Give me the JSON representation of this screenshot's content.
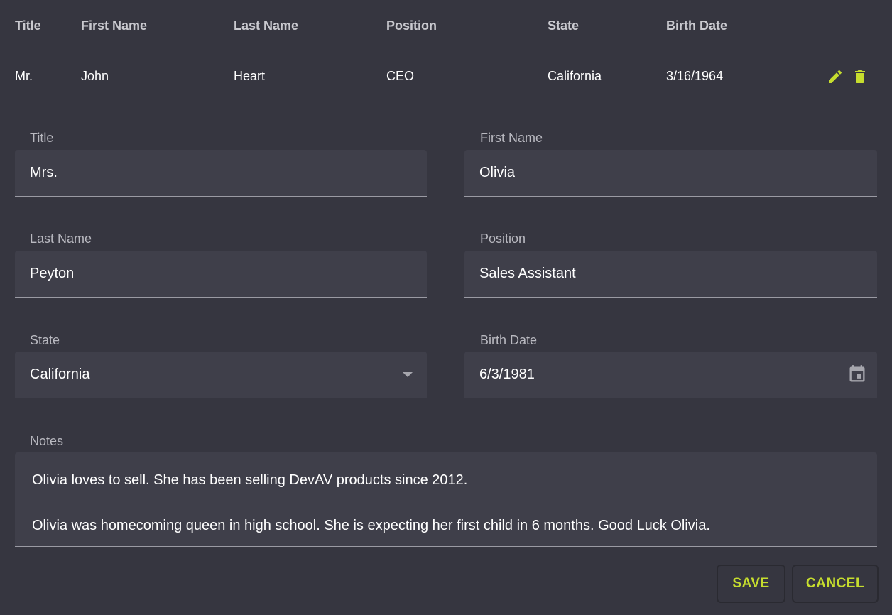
{
  "grid": {
    "columns": [
      "Title",
      "First Name",
      "Last Name",
      "Position",
      "State",
      "Birth Date"
    ],
    "row": {
      "title": "Mr.",
      "first_name": "John",
      "last_name": "Heart",
      "position": "CEO",
      "state": "California",
      "birth_date": "3/16/1964"
    },
    "icons": {
      "edit": "pencil-icon",
      "delete": "trash-icon"
    }
  },
  "form": {
    "title": {
      "label": "Title",
      "value": "Mrs."
    },
    "first_name": {
      "label": "First Name",
      "value": "Olivia"
    },
    "last_name": {
      "label": "Last Name",
      "value": "Peyton"
    },
    "position": {
      "label": "Position",
      "value": "Sales Assistant"
    },
    "state": {
      "label": "State",
      "value": "California"
    },
    "birth_date": {
      "label": "Birth Date",
      "value": "6/3/1981"
    },
    "notes": {
      "label": "Notes",
      "lines": [
        "Olivia loves to sell. She has been selling DevAV products since 2012.",
        "Olivia was homecoming queen in high school. She is expecting her first child in 6 months. Good Luck Olivia."
      ]
    }
  },
  "buttons": {
    "save": "SAVE",
    "cancel": "CANCEL"
  },
  "colors": {
    "background": "#363640",
    "field_background": "#3f3f4a",
    "accent": "#c6dd2e"
  }
}
